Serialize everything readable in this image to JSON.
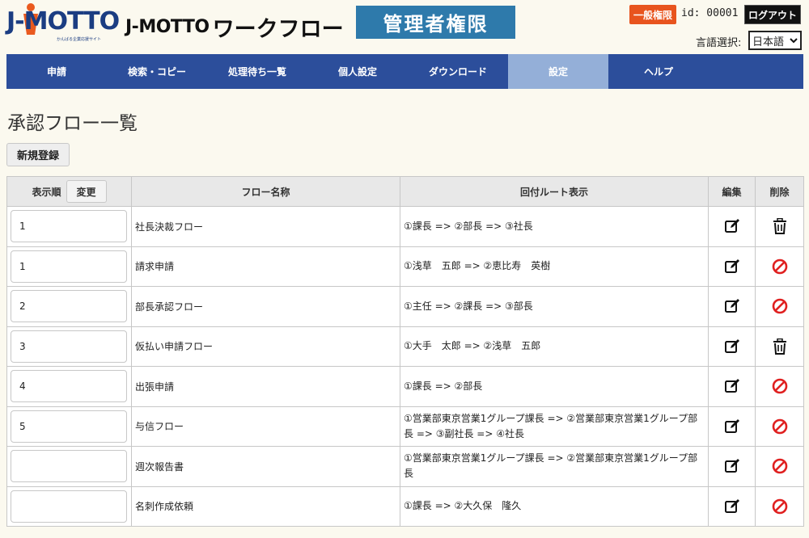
{
  "header": {
    "logo_text": "J-MOTTO",
    "logo_sub": "かんばる企業応援サイト",
    "app_title_prefix": "J-MOTTO",
    "app_title_main": "ワークフロー",
    "admin_label": "管理者権限",
    "general_badge": "一般権限",
    "user_id": "id: 00001",
    "logout_label": "ログアウト",
    "language_label": "言語選択:",
    "language_value": "日本語"
  },
  "nav": {
    "items": [
      {
        "label": "申請",
        "active": false
      },
      {
        "label": "検索・コピー",
        "active": false
      },
      {
        "label": "処理待ち一覧",
        "active": false
      },
      {
        "label": "個人設定",
        "active": false
      },
      {
        "label": "ダウンロード",
        "active": false
      },
      {
        "label": "設定",
        "active": true
      },
      {
        "label": "ヘルプ",
        "active": false
      }
    ]
  },
  "page": {
    "title": "承認フロー一覧",
    "new_button": "新規登録"
  },
  "table": {
    "headers": {
      "order": "表示順",
      "change_button": "変更",
      "name": "フロー名称",
      "route": "回付ルート表示",
      "edit": "編集",
      "delete": "削除"
    },
    "rows": [
      {
        "order": "1",
        "name": "社長決裁フロー",
        "route": "①課長 => ②部長 => ③社長",
        "delete_icon": "trash-icon"
      },
      {
        "order": "1",
        "name": "請求申請",
        "route": "①浅草　五郎 => ②恵比寿　英樹",
        "delete_icon": "prohibited-icon"
      },
      {
        "order": "2",
        "name": "部長承認フロー",
        "route": "①主任 => ②課長 => ③部長",
        "delete_icon": "prohibited-icon"
      },
      {
        "order": "3",
        "name": "仮払い申請フロー",
        "route": "①大手　太郎 => ②浅草　五郎",
        "delete_icon": "trash-icon"
      },
      {
        "order": "4",
        "name": "出張申請",
        "route": "①課長 => ②部長",
        "delete_icon": "prohibited-icon"
      },
      {
        "order": "5",
        "name": "与信フロー",
        "route": "①営業部東京営業1グループ課長 => ②営業部東京営業1グループ部長 => ③副社長 => ④社長",
        "delete_icon": "prohibited-icon"
      },
      {
        "order": "",
        "name": "週次報告書",
        "route": "①営業部東京営業1グループ課長 => ②営業部東京営業1グループ部長",
        "delete_icon": "prohibited-icon"
      },
      {
        "order": "",
        "name": "名刺作成依頼",
        "route": "①課長 => ②大久保　隆久",
        "delete_icon": "prohibited-icon"
      }
    ]
  },
  "colors": {
    "nav_bg": "#2c4e9b",
    "nav_active": "#94afd8",
    "admin_box": "#2e7aab",
    "badge_orange": "#e8541e",
    "prohibited_red": "#e02020",
    "page_bg": "#fbf9ef"
  }
}
